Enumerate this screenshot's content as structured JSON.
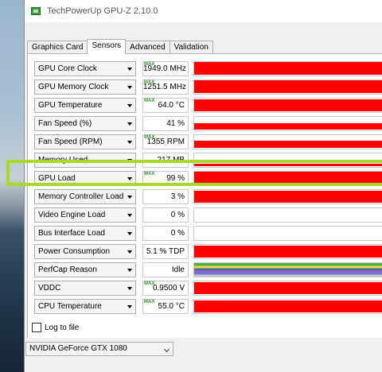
{
  "window": {
    "title": "TechPowerUp GPU-Z 2.10.0"
  },
  "tabs": [
    {
      "label": "Graphics Card"
    },
    {
      "label": "Sensors"
    },
    {
      "label": "Advanced"
    },
    {
      "label": "Validation"
    }
  ],
  "max_tag": "MAX",
  "sensors": [
    {
      "label": "GPU Core Clock",
      "value": "1949.0 MHz",
      "max": true,
      "level": 0.95
    },
    {
      "label": "GPU Memory Clock",
      "value": "1251.5 MHz",
      "max": true,
      "level": 0.95
    },
    {
      "label": "GPU Temperature",
      "value": "64.0 °C",
      "max": true,
      "level": 0.9
    },
    {
      "label": "Fan Speed (%)",
      "value": "41 %",
      "max": false,
      "level": 0.45
    },
    {
      "label": "Fan Speed (RPM)",
      "value": "1355 RPM",
      "max": true,
      "level": 0.5
    },
    {
      "label": "Memory Used",
      "value": "217 MB",
      "max": false,
      "level": 0.15
    },
    {
      "label": "GPU Load",
      "value": "99 %",
      "max": true,
      "level": 0.95
    },
    {
      "label": "Memory Controller Load",
      "value": "3 %",
      "max": false,
      "level": 0.9
    },
    {
      "label": "Video Engine Load",
      "value": "0 %",
      "max": false,
      "level": 0
    },
    {
      "label": "Bus Interface Load",
      "value": "0 %",
      "max": false,
      "level": 0
    },
    {
      "label": "Power Consumption",
      "value": "5.1 % TDP",
      "max": false,
      "level": 0.9
    },
    {
      "label": "PerfCap Reason",
      "value": "Idle",
      "max": false,
      "level": 0,
      "multicolor": true
    },
    {
      "label": "VDDC",
      "value": "0.9500 V",
      "max": true,
      "level": 0.9
    },
    {
      "label": "CPU Temperature",
      "value": "55.0 °C",
      "max": true,
      "level": 0.9
    }
  ],
  "log_to_file": {
    "label": "Log to file",
    "checked": false
  },
  "device_select": {
    "value": "NVIDIA GeForce GTX 1080"
  },
  "colors": {
    "graph": "#ff0000",
    "highlight": "#a8d828",
    "max_tag": "#2c8f2c"
  }
}
